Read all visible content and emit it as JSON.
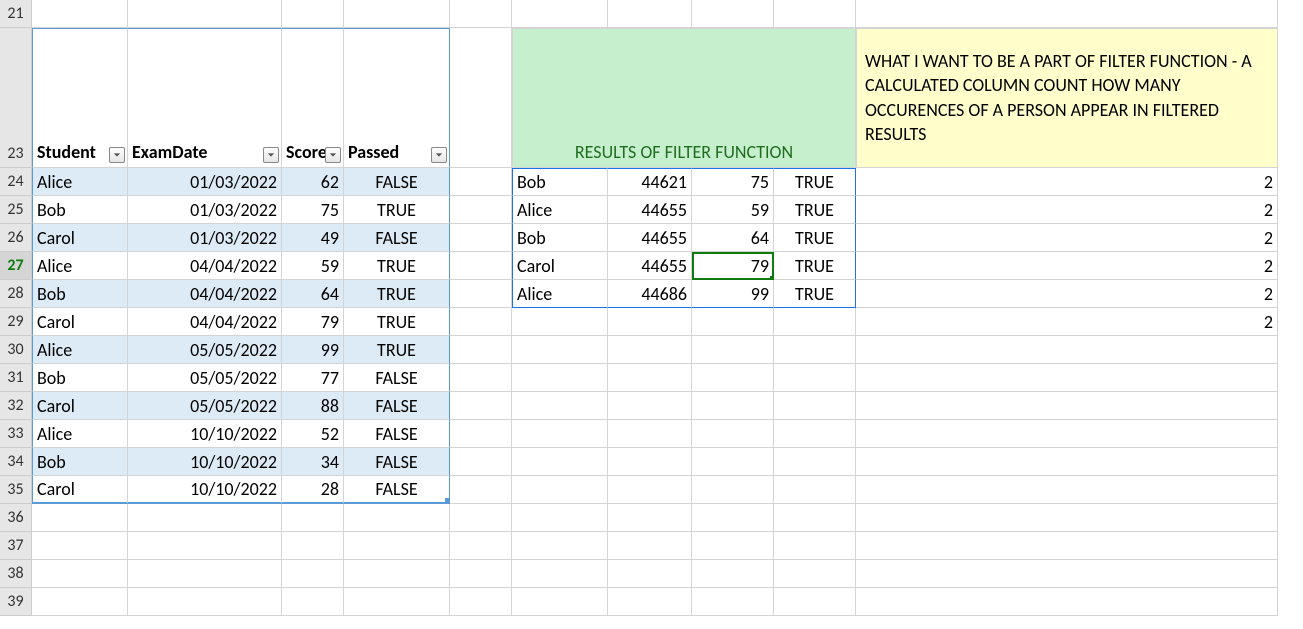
{
  "rowHeaders": [
    "21",
    "23",
    "24",
    "25",
    "26",
    "27",
    "28",
    "29",
    "30",
    "31",
    "32",
    "33",
    "34",
    "35",
    "36",
    "37",
    "38",
    "39"
  ],
  "activeRow": "27",
  "tableHeaders": {
    "student": "Student",
    "examDate": "ExamDate",
    "score": "Score",
    "passed": "Passed"
  },
  "tableRows": [
    {
      "student": "Alice",
      "date": "01/03/2022",
      "score": "62",
      "passed": "FALSE"
    },
    {
      "student": "Bob",
      "date": "01/03/2022",
      "score": "75",
      "passed": "TRUE"
    },
    {
      "student": "Carol",
      "date": "01/03/2022",
      "score": "49",
      "passed": "FALSE"
    },
    {
      "student": "Alice",
      "date": "04/04/2022",
      "score": "59",
      "passed": "TRUE"
    },
    {
      "student": "Bob",
      "date": "04/04/2022",
      "score": "64",
      "passed": "TRUE"
    },
    {
      "student": "Carol",
      "date": "04/04/2022",
      "score": "79",
      "passed": "TRUE"
    },
    {
      "student": "Alice",
      "date": "05/05/2022",
      "score": "99",
      "passed": "TRUE"
    },
    {
      "student": "Bob",
      "date": "05/05/2022",
      "score": "77",
      "passed": "FALSE"
    },
    {
      "student": "Carol",
      "date": "05/05/2022",
      "score": "88",
      "passed": "FALSE"
    },
    {
      "student": "Alice",
      "date": "10/10/2022",
      "score": "52",
      "passed": "FALSE"
    },
    {
      "student": "Bob",
      "date": "10/10/2022",
      "score": "34",
      "passed": "FALSE"
    },
    {
      "student": "Carol",
      "date": "10/10/2022",
      "score": "28",
      "passed": "FALSE"
    }
  ],
  "greenHeader": "RESULTS OF FILTER FUNCTION",
  "yellowNote": "WHAT I WANT TO BE A PART OF FILTER FUNCTION - A CALCULATED COLUMN COUNT HOW MANY OCCURENCES OF A PERSON APPEAR IN FILTERED RESULTS",
  "filterResults": [
    {
      "student": "Bob",
      "serial": "44621",
      "score": "75",
      "passed": "TRUE"
    },
    {
      "student": "Alice",
      "serial": "44655",
      "score": "59",
      "passed": "TRUE"
    },
    {
      "student": "Bob",
      "serial": "44655",
      "score": "64",
      "passed": "TRUE"
    },
    {
      "student": "Carol",
      "serial": "44655",
      "score": "79",
      "passed": "TRUE"
    },
    {
      "student": "Alice",
      "serial": "44686",
      "score": "99",
      "passed": "TRUE"
    }
  ],
  "counts": [
    "2",
    "2",
    "2",
    "2",
    "2",
    "2"
  ]
}
